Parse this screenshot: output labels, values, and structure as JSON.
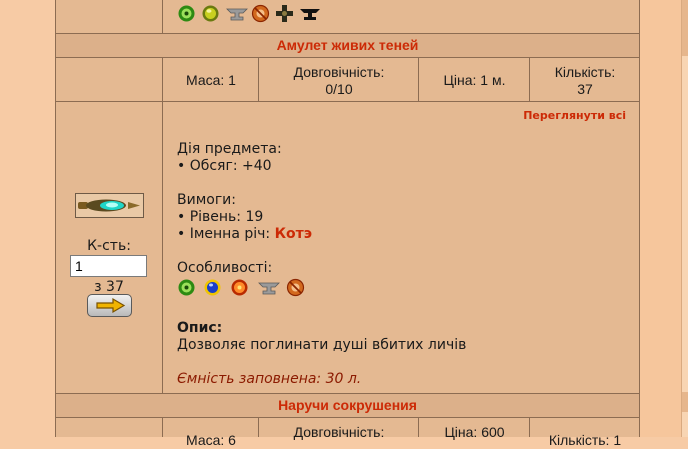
{
  "items": [
    {
      "title": "Амулет живих теней",
      "stats": {
        "mass": "Маса: 1",
        "durability_label": "Довговічність:",
        "durability_value": "0/10",
        "price": "Ціна: 1 м.",
        "count_label": "Кількість:",
        "count_value": "37"
      },
      "view_all": "Переглянути всі",
      "qty_label": "К-сть:",
      "qty_value": "1",
      "qty_total": "з 37",
      "action_heading": "Дія предмета:",
      "action_line": "• Обсяг: +40",
      "req_heading": "Вимоги:",
      "req_level": "• Рівень: 19",
      "req_named_prefix": "• Іменна річ:",
      "req_named_value": "Котэ",
      "features_heading": "Особливості:",
      "desc_heading": "Опис:",
      "desc_text": "Дозволяє поглинати душі вбитих личів",
      "capacity": "Ємність заповнена: 30 л."
    },
    {
      "title": "Наручи сокрушения",
      "stats": {
        "mass": "Маса: 6",
        "durability_label": "Довговічність:",
        "price": "Ціна: 600",
        "count_label": "Кількість: 1"
      }
    }
  ],
  "icons": {
    "top_row": [
      "green-swirl-icon",
      "green-orb-icon",
      "anvil-icon",
      "no-repair-icon",
      "dark-cross-icon",
      "black-anvil-icon"
    ],
    "features_row": [
      "green-swirl-icon",
      "blue-orb-icon",
      "red-orb-icon",
      "anvil-icon",
      "no-repair-icon"
    ]
  },
  "colors": {
    "accent": "#cc2a06",
    "capacity": "#8b1a00",
    "row_bg": "#e4b992",
    "title_bg": "#dcb08a",
    "page_bg": "#f7cba5"
  }
}
